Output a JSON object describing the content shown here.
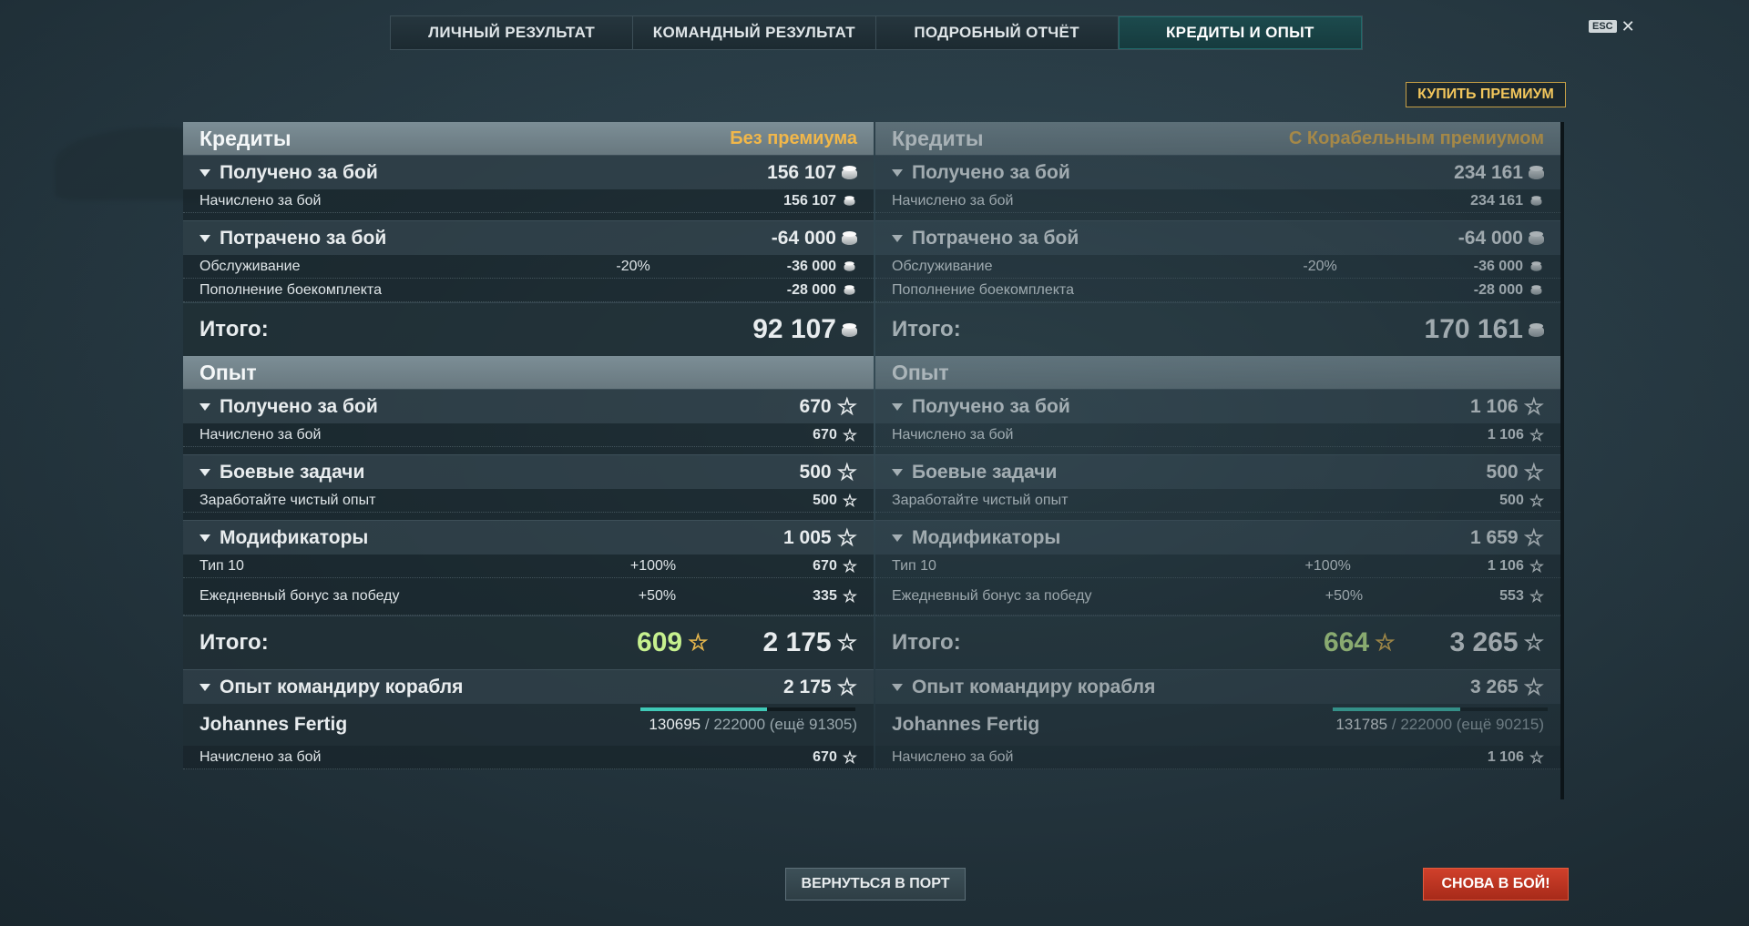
{
  "tabs": [
    {
      "label": "ЛИЧНЫЙ РЕЗУЛЬТАТ"
    },
    {
      "label": "КОМАНДНЫЙ РЕЗУЛЬТАТ"
    },
    {
      "label": "ПОДРОБНЫЙ ОТЧЁТ"
    },
    {
      "label": "КРЕДИТЫ И ОПЫТ",
      "active": true
    }
  ],
  "esc": {
    "key": "ESC",
    "close": "✕"
  },
  "premium_button": "КУПИТЬ ПРЕМИУМ",
  "left": {
    "credits_title": "Кредиты",
    "mode": "Без премиума",
    "earned_label": "Получено за бой",
    "earned_value": "156 107",
    "earned_row_label": "Начислено за бой",
    "earned_row_value": "156 107",
    "spent_label": "Потрачено за бой",
    "spent_value": "-64 000",
    "service_label": "Обслуживание",
    "service_pct": "-20%",
    "service_value": "-36 000",
    "ammo_label": "Пополнение боекомплекта",
    "ammo_value": "-28 000",
    "credits_total_label": "Итого:",
    "credits_total_value": "92 107",
    "xp_title": "Опыт",
    "xp_earned_label": "Получено за бой",
    "xp_earned_value": "670",
    "xp_earned_row_label": "Начислено за бой",
    "xp_earned_row_value": "670",
    "tasks_label": "Боевые задачи",
    "tasks_value": "500",
    "task_row_label": "Заработайте чистый опыт",
    "task_row_value": "500",
    "mods_label": "Модификаторы",
    "mods_value": "1 005",
    "mod1_label": "Тип 10",
    "mod1_pct": "+100%",
    "mod1_value": "670",
    "mod2_label": "Ежедневный бонус за победу",
    "mod2_pct": "+50%",
    "mod2_value": "335",
    "xp_total_label": "Итого:",
    "xp_total_free": "609",
    "xp_total_value": "2 175",
    "cmdr_label": "Опыт командиру корабля",
    "cmdr_value": "2 175",
    "cmdr_name": "Johannes Fertig",
    "cmdr_progress": "130695",
    "cmdr_progress_rest": "/ 222000 (ещё 91305)",
    "cmdr_progress_fraction": 0.589,
    "cmdr_row_label": "Начислено за бой",
    "cmdr_row_value": "670"
  },
  "right": {
    "credits_title": "Кредиты",
    "mode": "С Корабельным премиумом",
    "earned_label": "Получено за бой",
    "earned_value": "234 161",
    "earned_row_label": "Начислено за бой",
    "earned_row_value": "234 161",
    "spent_label": "Потрачено за бой",
    "spent_value": "-64 000",
    "service_label": "Обслуживание",
    "service_pct": "-20%",
    "service_value": "-36 000",
    "ammo_label": "Пополнение боекомплекта",
    "ammo_value": "-28 000",
    "credits_total_label": "Итого:",
    "credits_total_value": "170 161",
    "xp_title": "Опыт",
    "xp_earned_label": "Получено за бой",
    "xp_earned_value": "1 106",
    "xp_earned_row_label": "Начислено за бой",
    "xp_earned_row_value": "1 106",
    "tasks_label": "Боевые задачи",
    "tasks_value": "500",
    "task_row_label": "Заработайте чистый опыт",
    "task_row_value": "500",
    "mods_label": "Модификаторы",
    "mods_value": "1 659",
    "mod1_label": "Тип 10",
    "mod1_pct": "+100%",
    "mod1_value": "1 106",
    "mod2_label": "Ежедневный бонус за победу",
    "mod2_pct": "+50%",
    "mod2_value": "553",
    "xp_total_label": "Итого:",
    "xp_total_free": "664",
    "xp_total_value": "3 265",
    "cmdr_label": "Опыт командиру корабля",
    "cmdr_value": "3 265",
    "cmdr_name": "Johannes Fertig",
    "cmdr_progress": "131785",
    "cmdr_progress_rest": "/ 222000 (ещё 90215)",
    "cmdr_progress_fraction": 0.594,
    "cmdr_row_label": "Начислено за бой",
    "cmdr_row_value": "1 106"
  },
  "buttons": {
    "port": "ВЕРНУТЬСЯ В ПОРТ",
    "battle": "СНОВА В БОЙ!"
  },
  "colors": {
    "accent": "#1f6a6a",
    "premium": "#f1b74a",
    "free_xp": "#c6f08e",
    "battle": "#c2361f"
  }
}
